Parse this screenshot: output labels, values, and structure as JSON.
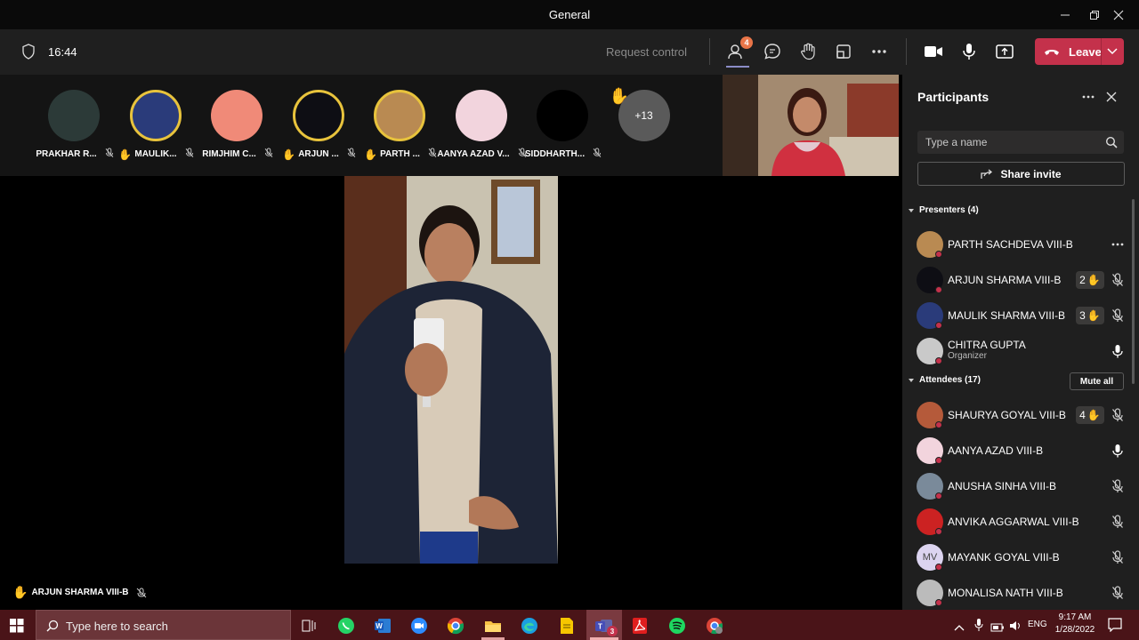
{
  "window": {
    "title": "General"
  },
  "toolbar": {
    "time": "16:44",
    "request_control": "Request control",
    "participants_badge": "4",
    "leave_label": "Leave"
  },
  "strip": {
    "tiles": [
      {
        "name": "PRAKHAR R...",
        "hand": false,
        "avatar_color": "#2c3a38"
      },
      {
        "name": "MAULIK...",
        "hand": true,
        "avatar_color": "#2a3b7a"
      },
      {
        "name": "RIMJHIM C...",
        "hand": false,
        "avatar_color": "#f08a78"
      },
      {
        "name": "ARJUN ...",
        "hand": true,
        "avatar_color": "#0e0e14"
      },
      {
        "name": "PARTH ...",
        "hand": true,
        "avatar_color": "#b98a52"
      },
      {
        "name": "AANYA AZAD V...",
        "hand": false,
        "avatar_color": "#f2d4dd"
      },
      {
        "name": "SIDDHARTH...",
        "hand": false,
        "avatar_color": "#000000"
      }
    ],
    "more_count": "+13"
  },
  "stage": {
    "speaker_name": "ARJUN SHARMA VIII-B"
  },
  "panel": {
    "title": "Participants",
    "search_placeholder": "Type a name",
    "share_invite": "Share invite",
    "presenters_header": "Presenters (4)",
    "attendees_header": "Attendees (17)",
    "mute_all": "Mute all",
    "presenters": [
      {
        "name": "PARTH SACHDEVA VIII-B",
        "sub": "",
        "hand_order": "",
        "mic": "more",
        "avatar_color": "#b98a52"
      },
      {
        "name": "ARJUN SHARMA VIII-B",
        "sub": "",
        "hand_order": "2",
        "mic": "muted",
        "avatar_color": "#0e0e14"
      },
      {
        "name": "MAULIK SHARMA VIII-B",
        "sub": "",
        "hand_order": "3",
        "mic": "muted",
        "avatar_color": "#2a3b7a"
      },
      {
        "name": "CHITRA GUPTA",
        "sub": "Organizer",
        "hand_order": "",
        "mic": "on",
        "avatar_color": "#c9c9c9"
      }
    ],
    "attendees": [
      {
        "name": "SHAURYA GOYAL VIII-B",
        "hand_order": "4",
        "mic": "muted",
        "avatar_color": "#b55a3a"
      },
      {
        "name": "AANYA AZAD VIII-B",
        "hand_order": "",
        "mic": "on",
        "avatar_color": "#f2d4dd"
      },
      {
        "name": "ANUSHA SINHA VIII-B",
        "hand_order": "",
        "mic": "muted",
        "avatar_color": "#7a8a9a"
      },
      {
        "name": "ANVIKA AGGARWAL VIII-B",
        "hand_order": "",
        "mic": "muted",
        "avatar_color": "#cc2222"
      },
      {
        "name": "MAYANK GOYAL VIII-B",
        "initials": "MV",
        "hand_order": "",
        "mic": "muted",
        "avatar_color": "#dcd4f0"
      },
      {
        "name": "MONALISA NATH VIII-B",
        "hand_order": "",
        "mic": "muted",
        "avatar_color": "#bbbbbb"
      }
    ]
  },
  "taskbar": {
    "search_placeholder": "Type here to search",
    "lang": "ENG",
    "time": "9:17 AM",
    "date": "1/28/2022",
    "teams_badge": "3"
  },
  "colors": {
    "leave": "#c4314b",
    "hand": "#e8c33c",
    "accent": "#8b8cc7"
  }
}
